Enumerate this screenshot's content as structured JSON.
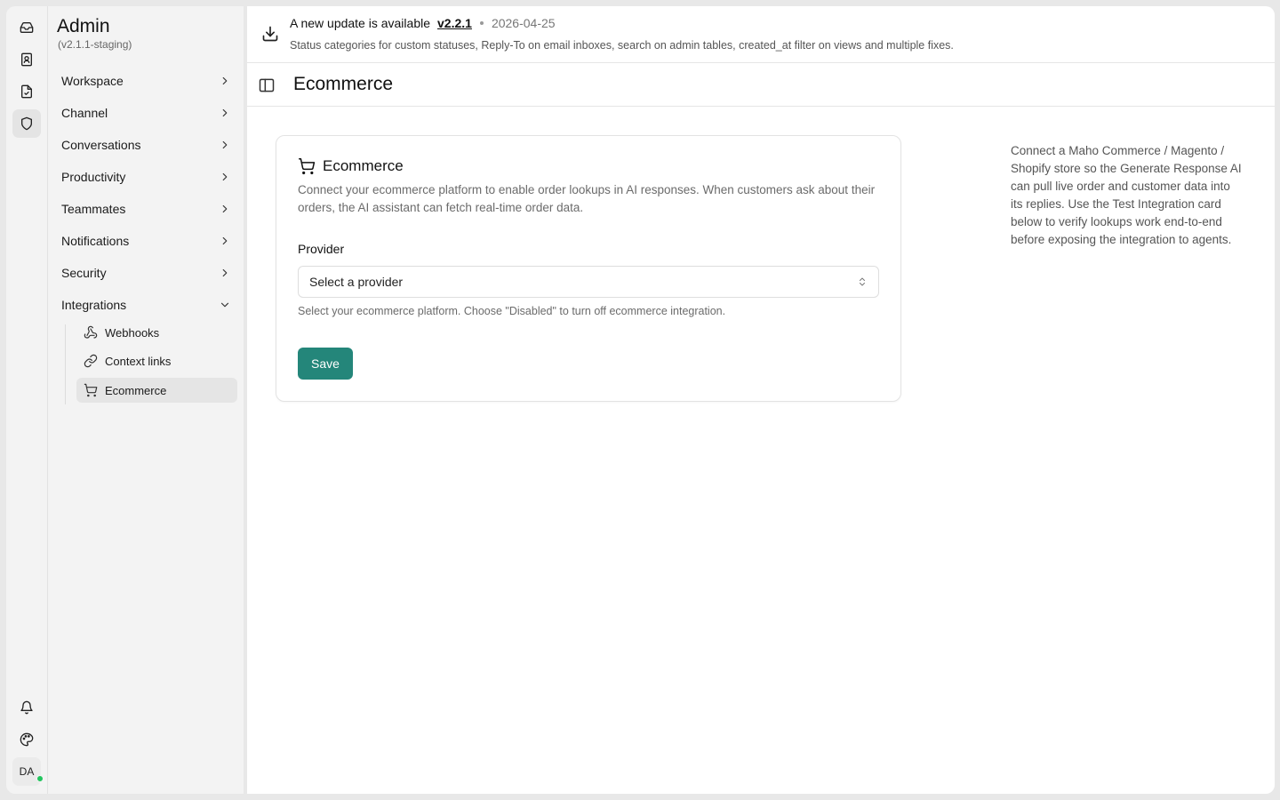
{
  "rail": {
    "avatar_initials": "DA",
    "top_icons": [
      "inbox-icon",
      "contacts-icon",
      "reports-icon",
      "admin-shield-icon"
    ],
    "bottom_icons": [
      "bell-icon",
      "palette-icon"
    ]
  },
  "sidebar": {
    "title": "Admin",
    "version": "(v2.1.1-staging)",
    "items": [
      {
        "label": "Workspace"
      },
      {
        "label": "Channel"
      },
      {
        "label": "Conversations"
      },
      {
        "label": "Productivity"
      },
      {
        "label": "Teammates"
      },
      {
        "label": "Notifications"
      },
      {
        "label": "Security"
      },
      {
        "label": "Integrations"
      }
    ],
    "integrations_sub": [
      {
        "label": "Webhooks"
      },
      {
        "label": "Context links"
      },
      {
        "label": "Ecommerce"
      }
    ]
  },
  "banner": {
    "label": "A new update is available",
    "version": "v2.2.1",
    "date": "2026-04-25",
    "description": "Status categories for custom statuses, Reply-To on email inboxes, search on admin tables, created_at filter on views and multiple fixes."
  },
  "page": {
    "title": "Ecommerce"
  },
  "card": {
    "title": "Ecommerce",
    "description": "Connect your ecommerce platform to enable order lookups in AI responses. When customers ask about their orders, the AI assistant can fetch real-time order data.",
    "provider_label": "Provider",
    "provider_value": "Select a provider",
    "hint": "Select your ecommerce platform. Choose \"Disabled\" to turn off ecommerce integration.",
    "save_label": "Save"
  },
  "help": {
    "text": "Connect a Maho Commerce / Magento / Shopify store so the Generate Response AI can pull live order and customer data into its replies. Use the Test Integration card below to verify lookups work end-to-end before exposing the integration to agents."
  },
  "colors": {
    "accent": "#24867a",
    "online": "#22c55e"
  }
}
